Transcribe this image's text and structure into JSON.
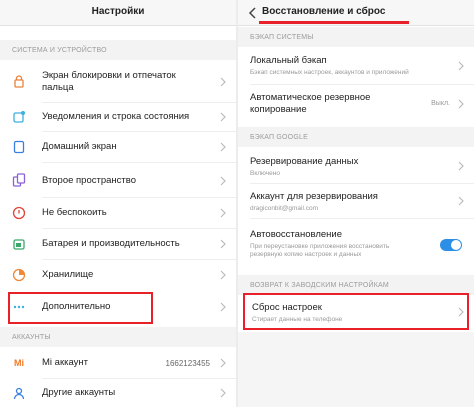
{
  "left": {
    "title": "Настройки",
    "section_system": "СИСТЕМА И УСТРОЙСТВО",
    "items": [
      {
        "label": "Экран блокировки и отпечаток\nпальца",
        "icon": "lock-icon"
      },
      {
        "label": "Уведомления и строка состояния",
        "icon": "notification-icon"
      },
      {
        "label": "Домашний экран",
        "icon": "home-icon"
      },
      {
        "label": "Второе пространство",
        "icon": "second-space-icon"
      },
      {
        "label": "Не беспокоить",
        "icon": "do-not-disturb-icon"
      },
      {
        "label": "Батарея и производительность",
        "icon": "battery-icon"
      },
      {
        "label": "Хранилище",
        "icon": "storage-icon"
      },
      {
        "label": "Дополнительно",
        "icon": "more-icon"
      }
    ],
    "section_accounts": "АККАУНТЫ",
    "accounts": [
      {
        "label": "Mi аккаунт",
        "value": "1662123455",
        "icon": "mi-icon"
      },
      {
        "label": "Другие аккаунты",
        "icon": "accounts-icon"
      }
    ]
  },
  "right": {
    "title": "Восстановление и сброс",
    "section_backup": "БЭКАП СИСТЕМЫ",
    "local_backup": {
      "label": "Локальный бэкап",
      "sub": "Бэкап системных настроек, аккаунтов и приложений"
    },
    "auto_backup": {
      "label": "Автоматическое резервное\nкопирование",
      "value": "Выкл."
    },
    "section_google": "БЭКАП GOOGLE",
    "data_backup": {
      "label": "Резервирование данных",
      "sub": "Включено"
    },
    "backup_account": {
      "label": "Аккаунт для резервирования",
      "sub": "dragiconbit@gmail.com"
    },
    "auto_restore": {
      "label": "Автовосстановление",
      "sub": "При переустановке приложения восстановить\nрезервную копию настроек и данных",
      "enabled": true
    },
    "section_factory": "ВОЗВРАТ К ЗАВОДСКИМ НАСТРОЙКАМ",
    "factory_reset": {
      "label": "Сброс настроек",
      "sub": "Стирает данные на телефоне"
    }
  },
  "colors": {
    "highlight": "#e8202a",
    "accent": "#2d8ee6"
  }
}
